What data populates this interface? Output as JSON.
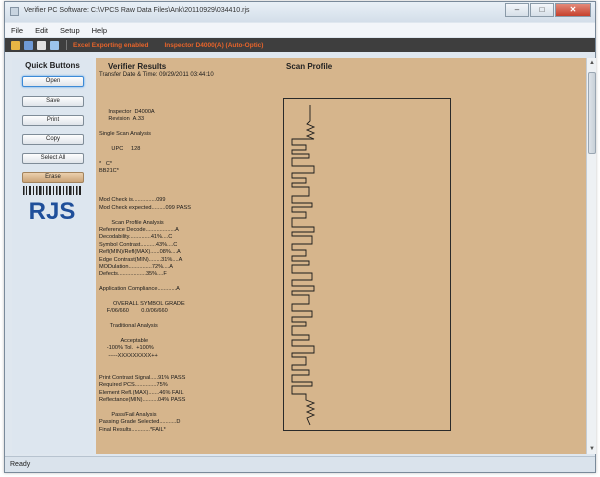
{
  "window": {
    "title": "Verifier PC Software: C:\\VPCS Raw Data Files\\Ank\\20110929\\034410.rjs"
  },
  "menu": [
    "File",
    "Edit",
    "Setup",
    "Help"
  ],
  "toolbar": {
    "icons": [
      "open-folder-icon",
      "save-disk-icon",
      "print-icon",
      "copy-icon"
    ],
    "status_left": "Excel Exporting enabled",
    "status_right": "Inspector D4000(A) (Auto-Optic)",
    "status_color": "#e8642a"
  },
  "sidebar": {
    "title": "Quick Buttons",
    "buttons": [
      "Open",
      "Save",
      "Print",
      "Copy",
      "Select All",
      "Erase"
    ],
    "logo_text": "RJS"
  },
  "results": {
    "heading": "Verifier Results",
    "transfer": "Transfer Date & Time:  09/29/2011  03:44:10",
    "lines": [
      "",
      "",
      "      Inspector  D4000A",
      "      Revision  A.33",
      "",
      "Single Scan Analysis",
      "",
      "        UPC     128",
      "",
      "*   C*",
      "BB21C*",
      "",
      "",
      "",
      "Mod Check is...............099",
      "Mod Check expected.........099 PASS",
      "",
      "        Scan Profile Analysis",
      "Reference Decode...................A",
      "Decodability..............41%....C",
      "Symbol Contrast..........43%....C",
      "Refl(MIN)/Refl(MAX)......08%....A",
      "Edge Contrast(MIN)........31%....A",
      "MODulation...............72%....A",
      "Defects..................35%....F",
      "",
      "Application Compliance............A",
      "",
      "         OVERALL SYMBOL GRADE",
      "     F/06/660        0.0/06/660",
      "",
      "       Traditional Analysis",
      "",
      "              Acceptable",
      "     -100% Tol.  +100%",
      "      -----XXXXXXXXX++",
      "",
      "",
      "Print Contrast Signal.....91% PASS",
      "Required PCS..............75%",
      "Element Refl.(MAX).......46% FAIL",
      "Reflectance(MIN)..........04% PASS",
      "",
      "        Pass/Fail Analysis",
      "Passing Grade Selected...........D",
      "Final Results............*FAIL*"
    ]
  },
  "profile": {
    "heading": "Scan Profile"
  },
  "status": {
    "text": "Ready"
  },
  "colors": {
    "results_background": "#d6b58c",
    "toolbar_background": "#3e3e3e",
    "logo_blue": "#1f4f9a"
  }
}
